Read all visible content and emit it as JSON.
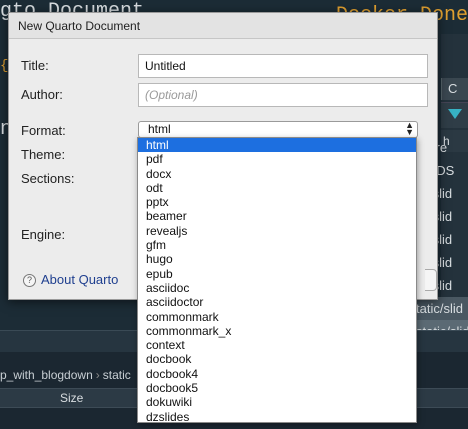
{
  "background": {
    "code_left": "gto Document",
    "code_right": "Docker Done",
    "orange_hint": "{",
    "code_n": "n",
    "right_tab": "C",
    "right_header": "h",
    "files": [
      "Store",
      "tic/.DS",
      "tic/slid",
      "tic/slid",
      "tic/slid",
      "tic/slid",
      "tic/slid",
      "tatic/slid",
      "static/slid"
    ],
    "breadcrumb": [
      "p_with_blogdown",
      "static"
    ],
    "size_col": "Size"
  },
  "dialog": {
    "title": "New Quarto Document",
    "title_label": "Title:",
    "title_value": "Untitled",
    "author_label": "Author:",
    "author_placeholder": "(Optional)",
    "format_label": "Format:",
    "format_value": "html",
    "theme_label": "Theme:",
    "sections_label": "Sections:",
    "engine_label": "Engine:",
    "about_link": "About Quarto",
    "help_glyph": "?"
  },
  "dropdown": {
    "selected_index": 0,
    "options": [
      "html",
      "pdf",
      "docx",
      "odt",
      "pptx",
      "beamer",
      "revealjs",
      "gfm",
      "hugo",
      "epub",
      "asciidoc",
      "asciidoctor",
      "commonmark",
      "commonmark_x",
      "context",
      "docbook",
      "docbook4",
      "docbook5",
      "dokuwiki",
      "dzslides"
    ]
  },
  "colors": {
    "selection": "#1d6fe0",
    "link": "#1f3f8f"
  }
}
